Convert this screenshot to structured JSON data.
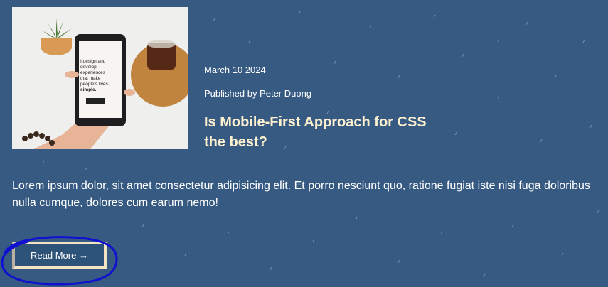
{
  "post": {
    "date": "March 10 2024",
    "author_line": "Published by Peter Duong",
    "title": "Is Mobile-First Approach for CSS the best?",
    "excerpt": "Lorem ipsum dolor, sit amet consectetur adipisicing elit. Et porro nesciunt quo, ratione fugiat iste nisi fuga doloribus nulla cumque, dolores cum earum nemo!",
    "read_more_label": "Read More →"
  },
  "thumbnail": {
    "phone_text_lines": [
      "I design and",
      "develop",
      "experiences",
      "that make",
      "people's lives",
      "simple."
    ]
  },
  "colors": {
    "background": "#365a82",
    "title": "#fdf0cf",
    "button_border": "#f2e3c4",
    "annotation": "#1010d0"
  }
}
